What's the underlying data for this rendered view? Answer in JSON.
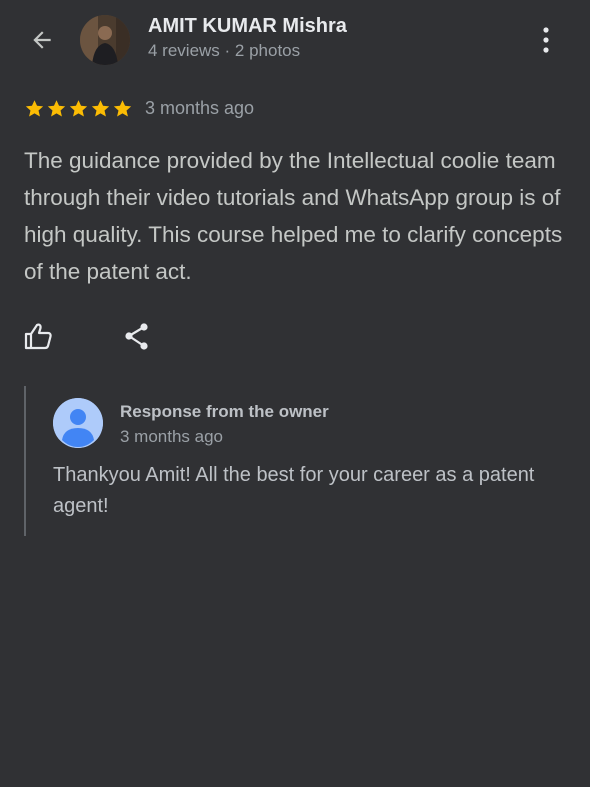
{
  "reviewer": {
    "name": "AMIT KUMAR Mishra",
    "meta": "4 reviews · 2 photos"
  },
  "review": {
    "stars": 5,
    "star_color": "#fbbc04",
    "time": "3 months ago",
    "text": "The guidance provided by the Intellectual coolie team through their video tutorials and WhatsApp group is of high quality. This course helped me to clarify concepts of the patent act."
  },
  "owner_response": {
    "title": "Response from the owner",
    "time": "3 months ago",
    "text": "Thankyou Amit! All the best for your career as a patent agent!"
  },
  "icons": {
    "back": "arrow-left-icon",
    "more": "more-vertical-icon",
    "like": "thumb-up-icon",
    "share": "share-icon"
  },
  "colors": {
    "background": "#303134",
    "owner_avatar": "#aecbfa",
    "owner_avatar_figure": "#4285f4"
  }
}
